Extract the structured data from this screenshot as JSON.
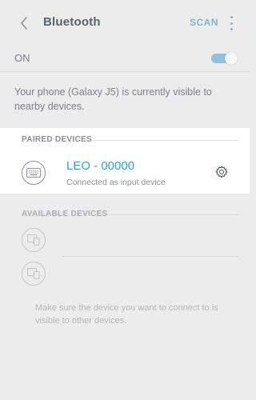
{
  "header": {
    "title": "Bluetooth",
    "scan_label": "SCAN",
    "back_icon": "chevron-left-icon",
    "more_icon": "more-vertical-icon"
  },
  "toggle_row": {
    "label": "ON",
    "state": "on"
  },
  "visibility_message": "Your phone (Galaxy J5) is currently visible to nearby devices.",
  "paired": {
    "section_label": "PAIRED DEVICES",
    "devices": [
      {
        "name": "LEO - 00000",
        "status": "Connected as input device",
        "icon": "keyboard-icon",
        "action_icon": "gear-icon"
      }
    ]
  },
  "available": {
    "section_label": "AVAILABLE DEVICES",
    "devices": [
      {
        "icon": "devices-icon"
      },
      {
        "icon": "devices-icon"
      }
    ],
    "hint": "Make sure the device you want to connect to is visible to other devices."
  },
  "colors": {
    "accent": "#27a1e0",
    "action_blue": "#7fb6d6",
    "toggle_track": "#8fc2e0",
    "background": "#ececec",
    "card": "#ffffff"
  }
}
